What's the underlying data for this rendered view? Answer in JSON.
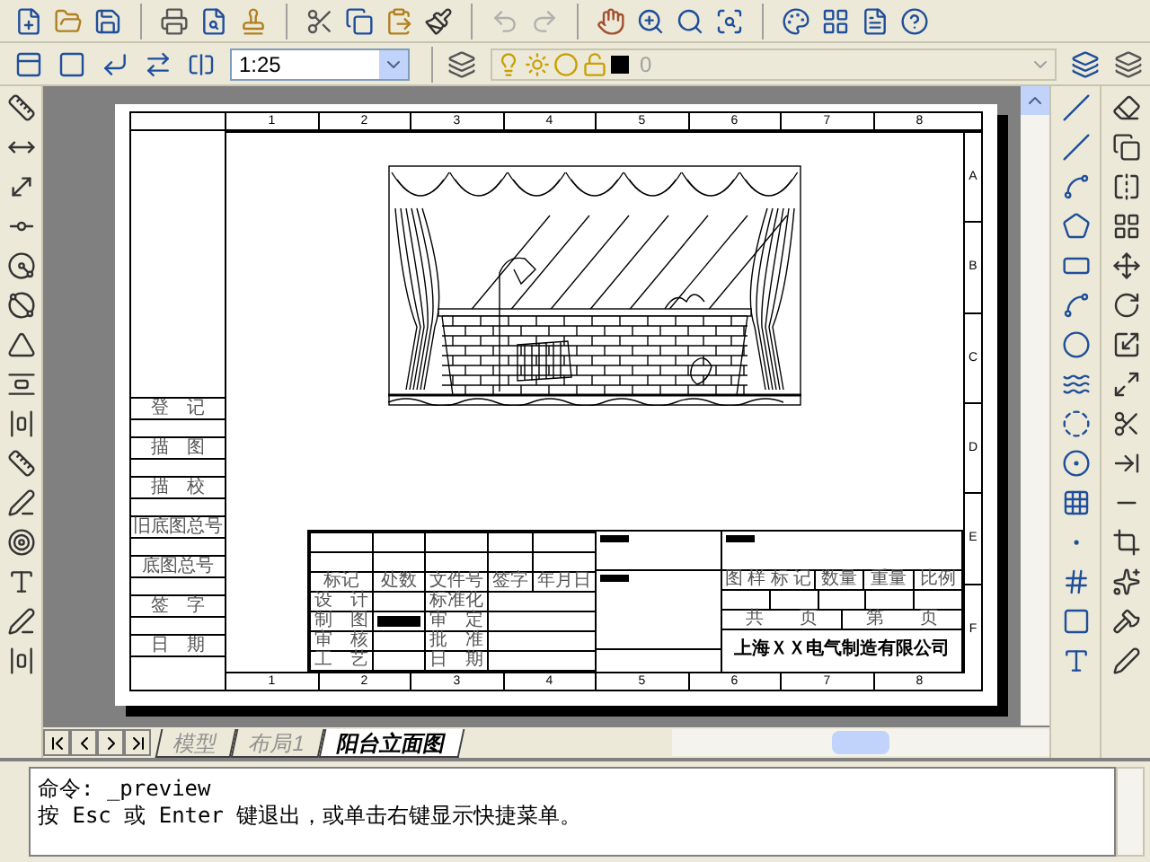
{
  "standard_toolbar": {
    "undo": {
      "disabled": true
    },
    "redo": {
      "disabled": true
    }
  },
  "properties_toolbar": {
    "scale": "1:25",
    "layer": {
      "name": "0",
      "disabled": true
    }
  },
  "drawing_sheet": {
    "top_marks": [
      "1",
      "2",
      "3",
      "4",
      "5",
      "6",
      "7",
      "8"
    ],
    "bottom_marks": [
      "1",
      "2",
      "3",
      "4",
      "5",
      "6",
      "7",
      "8"
    ],
    "side_marks": [
      "A",
      "B",
      "C",
      "D",
      "E",
      "F"
    ],
    "side_block": [
      "登　记",
      "描　图",
      "描　校",
      "旧底图总号",
      "底图总号",
      "签　字",
      "日　期"
    ],
    "title_block": {
      "revision_headers": [
        "标记",
        "处数",
        "文件号",
        "签字",
        "年月日"
      ],
      "left_labels": [
        "设　计",
        "制　图",
        "审　核",
        "工　艺"
      ],
      "right_labels": [
        "标准化",
        "审　定",
        "批　准",
        "日　期"
      ],
      "attribute_headers": [
        "图 样 标 记",
        "数量",
        "重量",
        "比例"
      ],
      "sheet_labels": [
        "共　　页",
        "第　　页"
      ],
      "company": "上海ＸＸ电气制造有限公司"
    }
  },
  "layout_tabs": [
    {
      "label": "模型",
      "selected": false
    },
    {
      "label": "布局1",
      "selected": false
    },
    {
      "label": "阳台立面图",
      "selected": true
    }
  ],
  "command_line": {
    "lines": [
      "命令: _preview",
      "按 Esc 或 Enter 键退出，或单击右键显示快捷菜单。"
    ]
  }
}
